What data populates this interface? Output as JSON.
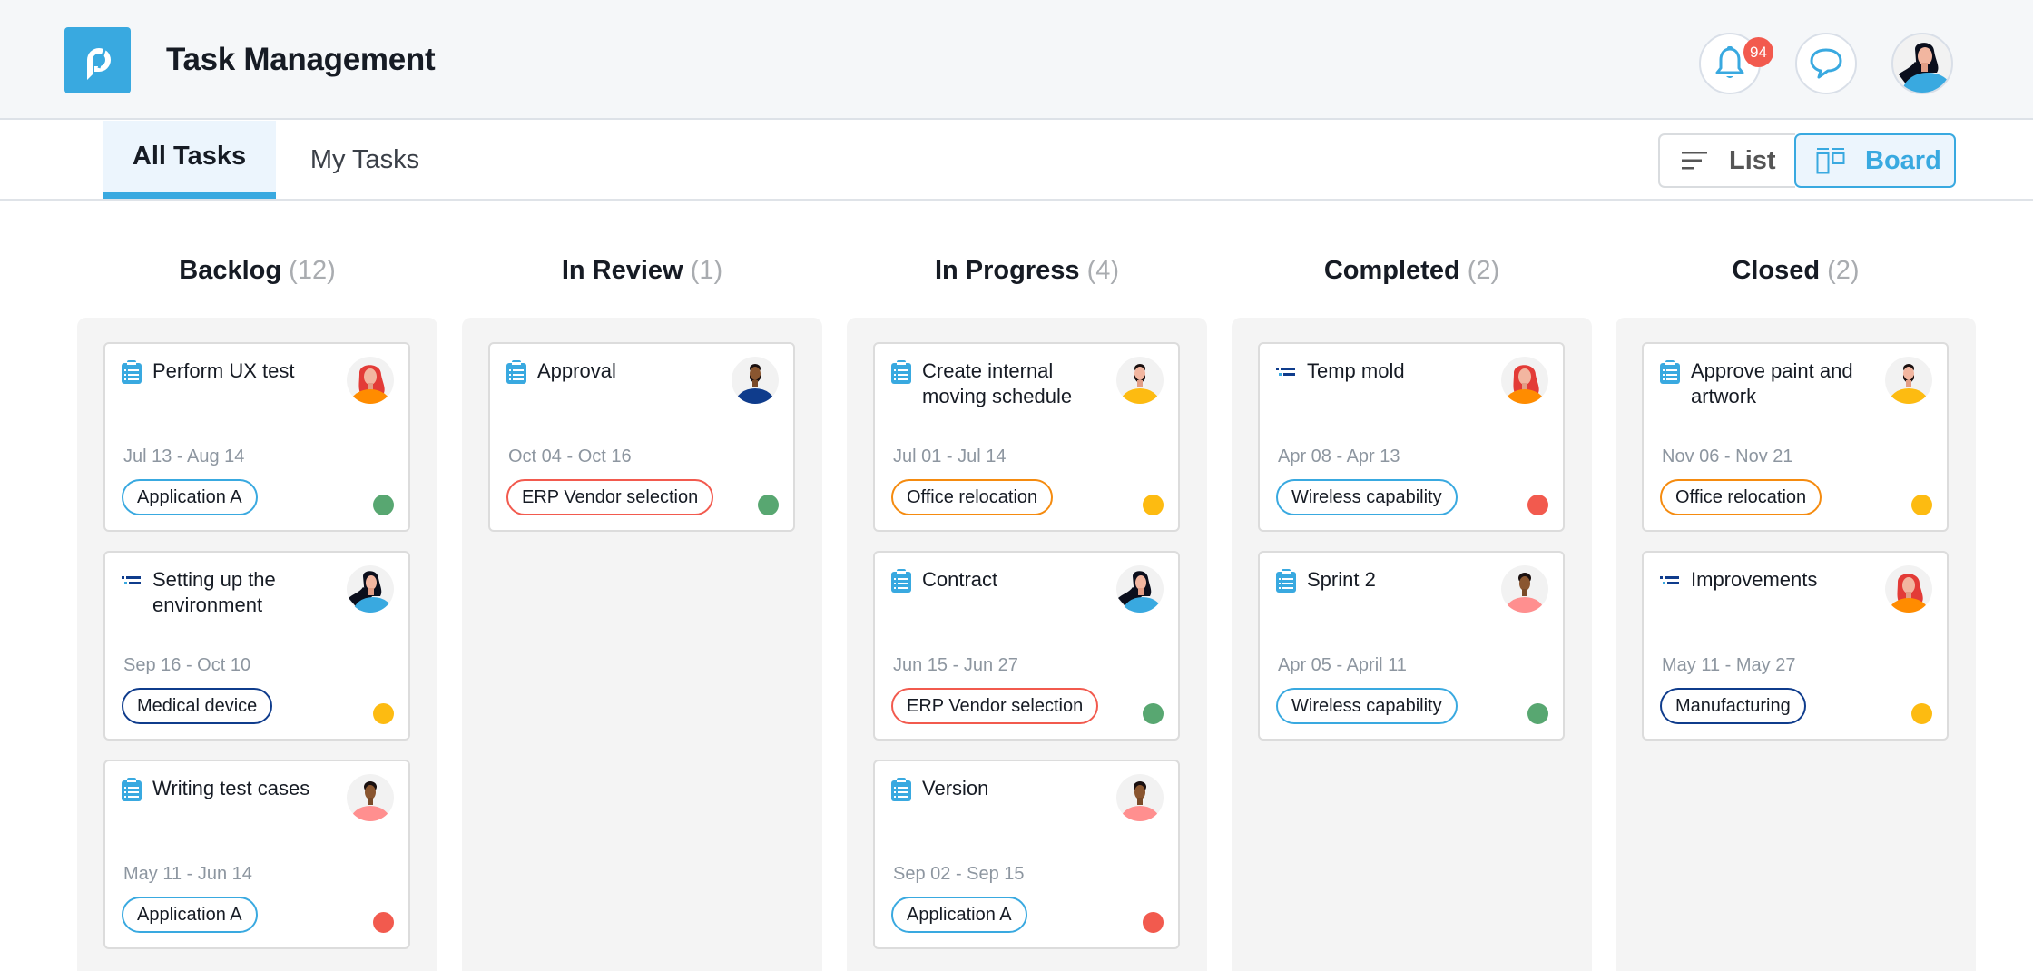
{
  "header": {
    "title": "Task Management",
    "logo": "p-logo-icon",
    "notifications": {
      "icon": "bell-icon",
      "count": "94"
    },
    "messages": {
      "icon": "chat-bubble-icon"
    },
    "user_avatar": "user-avatar"
  },
  "tabs": [
    {
      "label": "All Tasks",
      "active": true
    },
    {
      "label": "My Tasks",
      "active": false
    }
  ],
  "view_toggle": {
    "list_label": "List",
    "list_icon": "list-lines-icon",
    "board_label": "Board",
    "board_icon": "board-columns-icon",
    "active": "Board"
  },
  "colors": {
    "accent": "#39a9e0",
    "status_green": "#58a771",
    "status_yellow": "#fdbb11",
    "status_red": "#f25a4e",
    "tag_blue": "#39a9e0",
    "tag_navy": "#0f3c8c",
    "tag_red": "#f25a4e",
    "tag_orange": "#f58b0f"
  },
  "columns": [
    {
      "name": "Backlog",
      "count": "(12)",
      "cards": [
        {
          "title": "Perform UX test",
          "type": "clipboard-icon",
          "dates": "Jul 13 - Aug 14",
          "tag": "Application A",
          "tag_color": "#39a9e0",
          "status": "#58a771",
          "avatar": "woman-red-hair"
        },
        {
          "title": "Setting up the environment",
          "type": "subtask-list-icon",
          "dates": "Sep 16 - Oct 10",
          "tag": "Medical device",
          "tag_color": "#0f3c8c",
          "status": "#fdbb11",
          "avatar": "woman-dark-hair"
        },
        {
          "title": "Writing test cases",
          "type": "clipboard-icon",
          "dates": "May 11 - Jun 14",
          "tag": "Application A",
          "tag_color": "#39a9e0",
          "status": "#f25a4e",
          "avatar": "man-pink-shirt"
        }
      ]
    },
    {
      "name": "In Review",
      "count": "(1)",
      "cards": [
        {
          "title": "Approval",
          "type": "clipboard-icon",
          "dates": "Oct 04 - Oct 16",
          "tag": "ERP Vendor selection",
          "tag_color": "#f25a4e",
          "status": "#58a771",
          "avatar": "man-navy-shirt"
        }
      ]
    },
    {
      "name": "In Progress",
      "count": "(4)",
      "cards": [
        {
          "title": "Create internal moving schedule",
          "type": "clipboard-icon",
          "dates": "Jul 01 - Jul 14",
          "tag": "Office relocation",
          "tag_color": "#f58b0f",
          "status": "#fdbb11",
          "avatar": "man-yellow-shirt"
        },
        {
          "title": "Contract",
          "type": "clipboard-icon",
          "dates": "Jun 15 - Jun 27",
          "tag": "ERP Vendor selection",
          "tag_color": "#f25a4e",
          "status": "#58a771",
          "avatar": "woman-dark-hair"
        },
        {
          "title": "Version",
          "type": "clipboard-icon",
          "dates": "Sep 02 - Sep 15",
          "tag": "Application A",
          "tag_color": "#39a9e0",
          "status": "#f25a4e",
          "avatar": "man-pink-shirt"
        }
      ]
    },
    {
      "name": "Completed",
      "count": "(2)",
      "cards": [
        {
          "title": "Temp mold",
          "type": "subtask-list-icon",
          "dates": "Apr 08 - Apr 13",
          "tag": "Wireless capability",
          "tag_color": "#39a9e0",
          "status": "#f25a4e",
          "avatar": "woman-red-hair"
        },
        {
          "title": "Sprint 2",
          "type": "clipboard-icon",
          "dates": "Apr 05 - April 11",
          "tag": "Wireless capability",
          "tag_color": "#39a9e0",
          "status": "#58a771",
          "avatar": "man-pink-shirt"
        }
      ]
    },
    {
      "name": "Closed",
      "count": "(2)",
      "cards": [
        {
          "title": "Approve paint and artwork",
          "type": "clipboard-icon",
          "dates": "Nov 06 - Nov 21",
          "tag": "Office relocation",
          "tag_color": "#f58b0f",
          "status": "#fdbb11",
          "avatar": "man-yellow-shirt"
        },
        {
          "title": "Improvements",
          "type": "subtask-list-icon",
          "dates": "May 11 - May 27",
          "tag": "Manufacturing",
          "tag_color": "#0f3c8c",
          "status": "#fdbb11",
          "avatar": "woman-red-hair"
        }
      ]
    }
  ]
}
